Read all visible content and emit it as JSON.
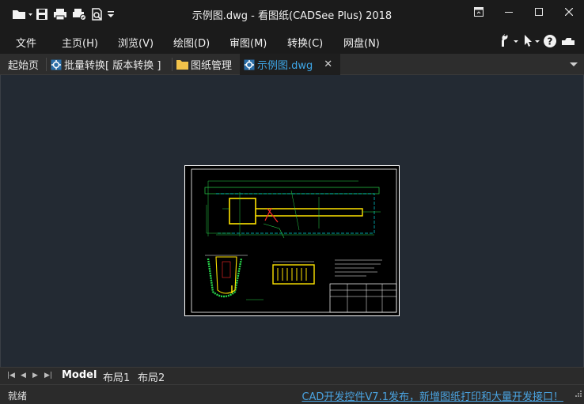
{
  "window": {
    "title": "示例图.dwg - 看图纸(CADSee Plus) 2018"
  },
  "quick_access": {
    "icons": [
      "folder-open-icon",
      "save-icon",
      "print-icon",
      "batch-print-icon",
      "print-preview-icon",
      "customize-dropdown-icon"
    ]
  },
  "menu": {
    "items": [
      {
        "label": "文件"
      },
      {
        "label": "主页(H)"
      },
      {
        "label": "浏览(V)"
      },
      {
        "label": "绘图(D)"
      },
      {
        "label": "审图(M)"
      },
      {
        "label": "转换(C)"
      },
      {
        "label": "网盘(N)"
      }
    ],
    "tools": [
      "wrench-icon",
      "cursor-icon",
      "help-icon",
      "cloud-icon"
    ]
  },
  "tabs": {
    "items": [
      {
        "label": "起始页",
        "icon": ""
      },
      {
        "label": "批量转换[ 版本转换 ]",
        "icon": "gear-icon"
      },
      {
        "label": "图纸管理",
        "icon": "folder-icon"
      },
      {
        "label": "示例图.dwg",
        "icon": "gear-icon",
        "active": true
      }
    ],
    "close_glyph": "✕"
  },
  "layouts": {
    "items": [
      {
        "label": "Model",
        "active": true
      },
      {
        "label": "布局1"
      },
      {
        "label": "布局2"
      }
    ]
  },
  "status": {
    "left": "就绪",
    "announcement": "CAD开发控件V7.1发布，新增图纸打印和大量开发接口！"
  },
  "colors": {
    "accent": "#3ea6e6",
    "link": "#4aa3e0",
    "cad_green": "#27d34a",
    "cad_yellow": "#ffe400",
    "cad_cyan": "#00d9e0",
    "cad_red": "#ff2a2a"
  }
}
